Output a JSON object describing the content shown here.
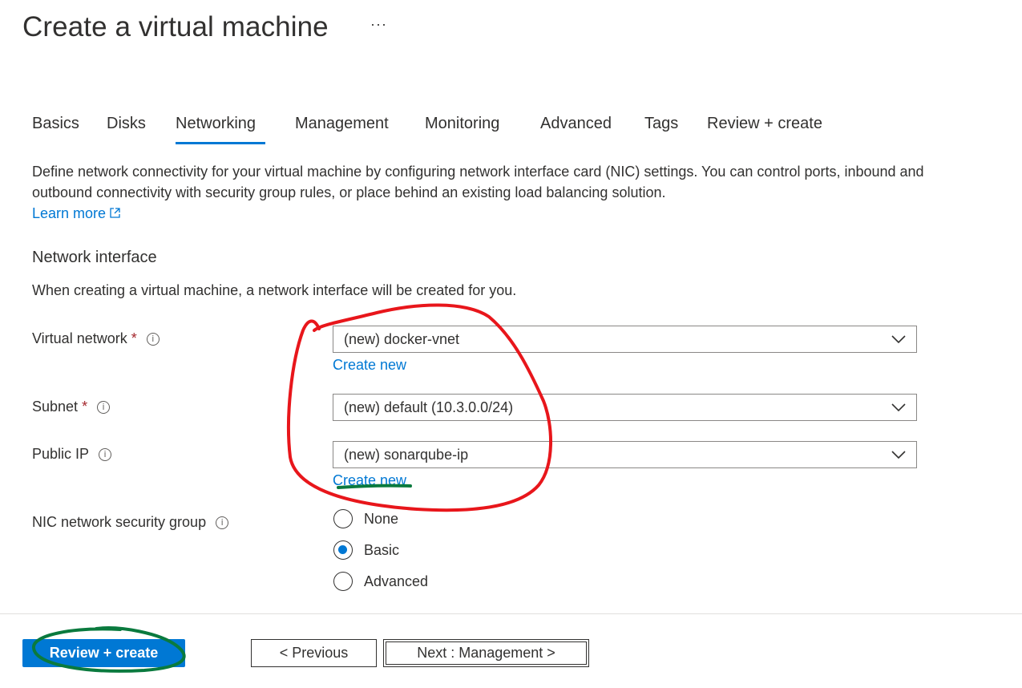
{
  "page": {
    "title": "Create a virtual machine",
    "more_label": "···"
  },
  "tabs": [
    {
      "label": "Basics"
    },
    {
      "label": "Disks"
    },
    {
      "label": "Networking",
      "selected": true
    },
    {
      "label": "Management"
    },
    {
      "label": "Monitoring"
    },
    {
      "label": "Advanced"
    },
    {
      "label": "Tags"
    },
    {
      "label": "Review + create"
    }
  ],
  "intro": {
    "text": "Define network connectivity for your virtual machine by configuring network interface card (NIC) settings. You can control ports, inbound and outbound connectivity with security group rules, or place behind an existing load balancing solution.",
    "learn_more": "Learn more"
  },
  "network_interface": {
    "title": "Network interface",
    "description": "When creating a virtual machine, a network interface will be created for you.",
    "virtual_network": {
      "label": "Virtual network",
      "required": "*",
      "value": "(new) docker-vnet",
      "create_new": "Create new"
    },
    "subnet": {
      "label": "Subnet",
      "required": "*",
      "value": "(new) default (10.3.0.0/24)"
    },
    "public_ip": {
      "label": "Public IP",
      "value": "(new) sonarqube-ip",
      "create_new": "Create new"
    },
    "nsg": {
      "label": "NIC network security group",
      "options": [
        {
          "label": "None",
          "selected": false
        },
        {
          "label": "Basic",
          "selected": true
        },
        {
          "label": "Advanced",
          "selected": false
        }
      ]
    }
  },
  "footer": {
    "review_create": "Review + create",
    "previous": "< Previous",
    "next": "Next : Management >"
  },
  "colors": {
    "accent": "#0078d4",
    "required": "#a4262c",
    "annotation_red": "#e8161b",
    "annotation_green": "#0a7a3e"
  },
  "icons": {
    "more": "ellipsis-icon",
    "external_link": "external-link-icon",
    "info": "info-icon",
    "dropdown": "chevron-down-icon"
  }
}
